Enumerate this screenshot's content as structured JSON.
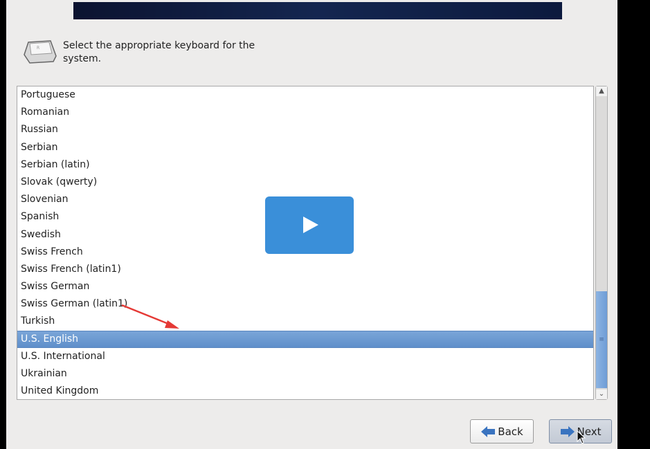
{
  "prompt": "Select the appropriate keyboard for the system.",
  "keyboards": [
    "Portuguese",
    "Romanian",
    "Russian",
    "Serbian",
    "Serbian (latin)",
    "Slovak (qwerty)",
    "Slovenian",
    "Spanish",
    "Swedish",
    "Swiss French",
    "Swiss French (latin1)",
    "Swiss German",
    "Swiss German (latin1)",
    "Turkish",
    "U.S. English",
    "U.S. International",
    "Ukrainian",
    "United Kingdom"
  ],
  "selected": "U.S. English",
  "buttons": {
    "back": "Back",
    "next": "Next"
  },
  "colors": {
    "selection": "#6b98d0",
    "annotation_arrow": "#e53935",
    "play_button": "#3a8fd9"
  }
}
